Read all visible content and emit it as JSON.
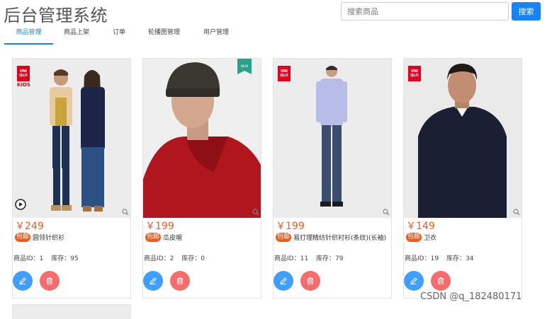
{
  "header": {
    "title": "后台管理系统",
    "search_placeholder": "搜索商品",
    "search_button": "搜索"
  },
  "tabs": [
    {
      "label": "商品管理",
      "active": true
    },
    {
      "label": "商品上架",
      "active": false
    },
    {
      "label": "订单",
      "active": false
    },
    {
      "label": "轮播图管理",
      "active": false
    },
    {
      "label": "用户管理",
      "active": false
    }
  ],
  "products": [
    {
      "price": "￥249",
      "free_shipping": "包邮",
      "name": "圆领针织衫",
      "id_label": "商品ID：",
      "id": "1",
      "stock_label": "库存：",
      "stock": "95",
      "image_badges": [
        "UNI",
        "QLO",
        "KIDS"
      ]
    },
    {
      "price": "￥199",
      "free_shipping": "包邮",
      "name": "瓜皮帽",
      "id_label": "商品ID：",
      "id": "2",
      "stock_label": "库存：",
      "stock": "0",
      "image_badges": [
        "NEW"
      ]
    },
    {
      "price": "￥199",
      "free_shipping": "包邮",
      "name": "易打理精纺针织衬衫(条纹)(长袖)",
      "id_label": "商品ID：",
      "id": "11",
      "stock_label": "库存：",
      "stock": "79",
      "image_badges": [
        "UNI",
        "QLO"
      ]
    },
    {
      "price": "￥149",
      "free_shipping": "包邮",
      "name": "卫衣",
      "id_label": "商品ID：",
      "id": "19",
      "stock_label": "库存：",
      "stock": "34",
      "image_badges": [
        "UNI",
        "QLO"
      ]
    }
  ],
  "icons": {
    "edit": "pencil-icon",
    "delete": "trash-icon",
    "zoom": "magnifier-icon",
    "play": "play-icon"
  },
  "watermark": "CSDN @q_182480171",
  "colors": {
    "primary": "#1784f5",
    "price": "#f05a1a",
    "edit_button": "#409eff",
    "delete_button": "#f56c6c",
    "brand_red": "#e3001b"
  }
}
